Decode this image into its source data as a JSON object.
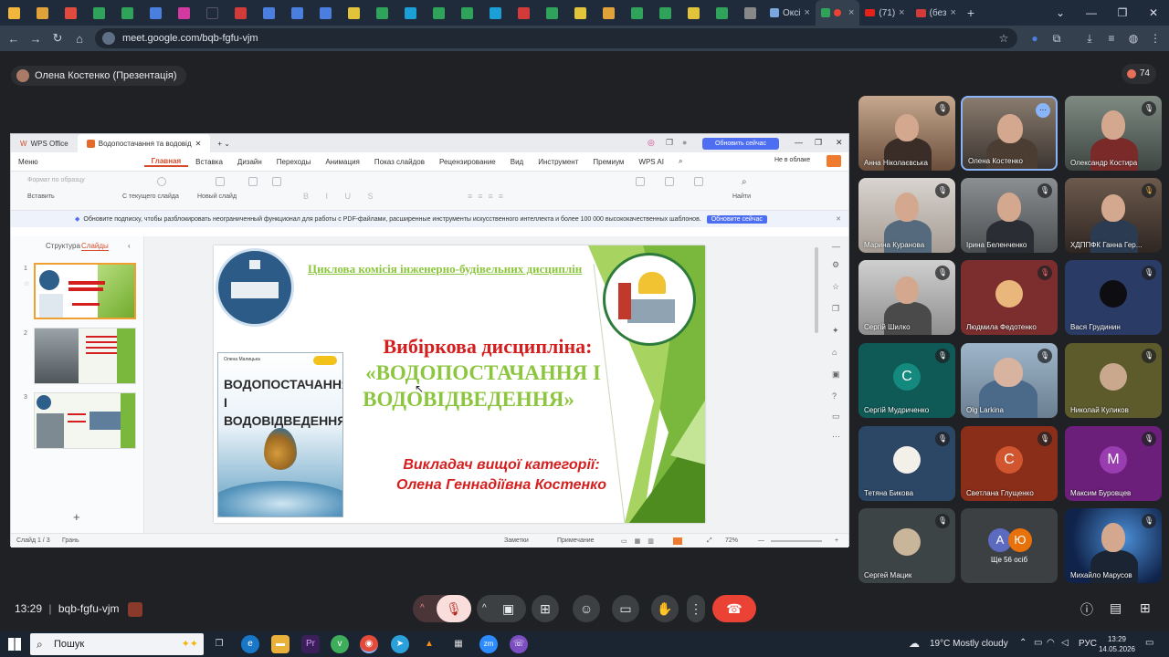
{
  "browser": {
    "tabs": [
      {
        "label": "Оксі",
        "close": "×"
      },
      {
        "label": "",
        "close": "×"
      },
      {
        "label": "(71)",
        "close": "×"
      },
      {
        "label": "(без",
        "close": "×"
      }
    ],
    "new_tab": "+",
    "url": "meet.google.com/bqb-fgfu-vjm"
  },
  "meet": {
    "presenter": "Олена Костенко (Презентація)",
    "participant_count": "74",
    "meeting_code": "bqb-fgfu-vjm",
    "time": "13:29",
    "participants": [
      {
        "name": "Анна Ніколаєвська",
        "type": "video",
        "muted": true
      },
      {
        "name": "Олена Костенко",
        "type": "video",
        "muted": false,
        "active": true
      },
      {
        "name": "Олександр Костира",
        "type": "video",
        "muted": true
      },
      {
        "name": "Марина Куранова",
        "type": "video",
        "muted": true
      },
      {
        "name": "Ірина Беленченко",
        "type": "video",
        "muted": true
      },
      {
        "name": "ХДППФК Ганна Гер...",
        "type": "video",
        "muted": true
      },
      {
        "name": "Сергій Шилко",
        "type": "video",
        "muted": true
      },
      {
        "name": "Людмила Федотенко",
        "type": "avatar",
        "muted": true
      },
      {
        "name": "Вася Грудинин",
        "type": "avatar",
        "muted": true
      },
      {
        "name": "Сергій Мудриченко",
        "type": "letter",
        "letter": "С",
        "muted": true
      },
      {
        "name": "Olg Larkina",
        "type": "avatar",
        "muted": true
      },
      {
        "name": "Николай Куликов",
        "type": "avatar",
        "muted": true
      },
      {
        "name": "Тетяна Бикова",
        "type": "avatar",
        "muted": true
      },
      {
        "name": "Светлана Глущенко",
        "type": "letter",
        "letter": "С",
        "muted": true
      },
      {
        "name": "Максим Буровцев",
        "type": "letter",
        "letter": "M",
        "muted": true
      },
      {
        "name": "Сергей Мацик",
        "type": "avatar",
        "muted": true
      },
      {
        "name": "Ще 56 осіб",
        "type": "more",
        "letters": [
          "А",
          "Ю"
        ]
      },
      {
        "name": "Михайло Марусов",
        "type": "video",
        "muted": true
      }
    ]
  },
  "wps": {
    "app_tab": "WPS Office",
    "doc_tab": "Водопостачання та водовід",
    "update_button": "Обновить сейчас",
    "menu": [
      "Меню",
      "Главная",
      "Вставка",
      "Дизайн",
      "Переходы",
      "Анимация",
      "Показ слайдов",
      "Рецензирование",
      "Вид",
      "Инструмент",
      "Премиум",
      "WPS AI"
    ],
    "not_in_cloud": "Не в облаке",
    "toolbar": {
      "format_painter": "Формат по образцу",
      "paste": "Вставить",
      "from_current": "С текущего слайда",
      "new_slide": "Новый слайд",
      "find": "Найти"
    },
    "promo_text": "Обновите подписку, чтобы разблокировать неограниченный функционал для работы с PDF-файлами, расширенные инструменты искусственного интеллекта и более 100 000 высококачественных шаблонов.",
    "promo_button": "Обновите сейчас",
    "panel_tabs": [
      "Структура",
      "Слайды"
    ],
    "status": {
      "slide": "Слайд 1 / 3",
      "theme": "Грань",
      "notes": "Заметки",
      "comment": "Примечание",
      "zoom": "72%"
    }
  },
  "slide": {
    "commission": "Циклова комісія інженерно-будівельних дисциплін",
    "line1": "Вибіркова дисципліна:",
    "line2": "«ВОДОПОСТАЧАННЯ І",
    "line3": "ВОДОВІДВЕДЕННЯ»",
    "teacher1": "Викладач вищої категорії:",
    "teacher2": "Олена Геннадіївна Костенко",
    "book_title1": "ВОДОПОСТАЧАННЯ",
    "book_title2": "І ВОДОВІДВЕДЕННЯ",
    "book_author": "Олена Малицька"
  },
  "taskbar": {
    "search": "Пошук",
    "weather": "19°C  Mostly cloudy",
    "lang": "РУС",
    "time": "13:29",
    "date": "14.05.2026"
  },
  "colors": {
    "accent_red": "#ea4335",
    "slide_green": "#7ab83d",
    "slide_title_red": "#d51f1f",
    "slide_subtitle_green": "#8cc63f",
    "wps_blue": "#4e6ef2"
  }
}
